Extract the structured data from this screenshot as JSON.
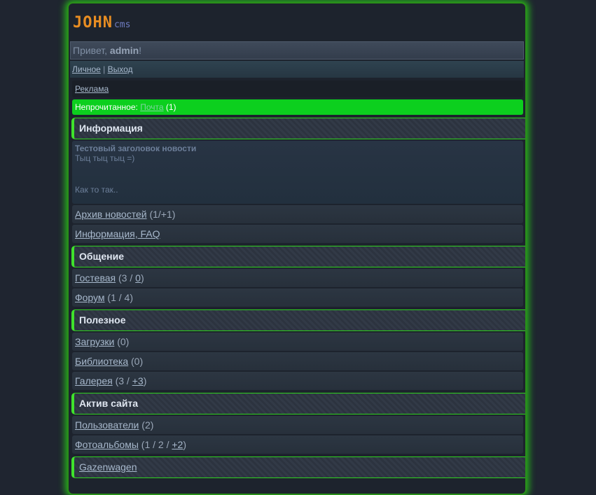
{
  "logo": {
    "main": "JOHN",
    "sub": "cms"
  },
  "greeting": {
    "prefix": "Привет, ",
    "user": "admin",
    "suffix": "!"
  },
  "usermenu": {
    "personal": "Личное",
    "sep": " | ",
    "logout": "Выход"
  },
  "ad": {
    "label": "Реклама"
  },
  "unread": {
    "prefix": "Непрочитанное: ",
    "link": "Почта",
    "count": " (1)"
  },
  "sections": {
    "info": "Информация",
    "communication": "Общение",
    "useful": "Полезное",
    "activity": "Актив сайта",
    "last": "Gazenwagen"
  },
  "news": {
    "title": "Тестовый заголовок новости",
    "line1": "Тыц тыц тыц =)",
    "line2": "Как то так.."
  },
  "rows": {
    "news_archive": {
      "label": "Архив новостей",
      "count": " (1/+1)"
    },
    "faq": {
      "label": "Информация, FAQ"
    },
    "guestbook": {
      "label": "Гостевая",
      "pre": " (3 / ",
      "link": "0",
      "post": ")"
    },
    "forum": {
      "label": "Форум",
      "count": " (1 / 4)"
    },
    "downloads": {
      "label": "Загрузки",
      "count": " (0)"
    },
    "library": {
      "label": "Библиотека",
      "count": " (0)"
    },
    "gallery": {
      "label": "Галерея",
      "pre": " (3 / ",
      "link": "+3",
      "post": ")"
    },
    "users": {
      "label": "Пользователи",
      "count": " (2)"
    },
    "photoalbums": {
      "label": "Фотоальбомы",
      "pre": " (1 / 2 / ",
      "link": "+2",
      "post": ")"
    }
  },
  "colors": {
    "accent_green": "#3fe22c",
    "logo_orange": "#e88d22",
    "unread_bg": "#0ccf1e"
  }
}
